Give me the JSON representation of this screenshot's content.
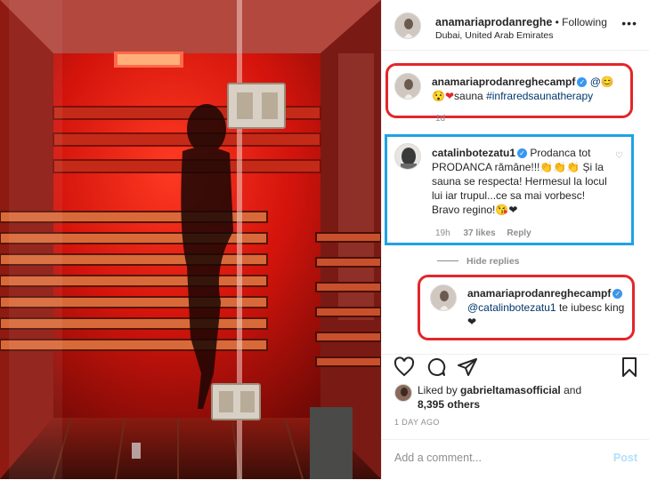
{
  "post": {
    "author": "anamariaprodanreghe",
    "follow_status": "• Following",
    "location": "Dubai, United Arab Emirates"
  },
  "caption": {
    "author": "anamariaprodanreghecampf",
    "mention": "@",
    "emoji_1": "😊",
    "emoji_2": "😯",
    "heart": "❤",
    "text": "sauna",
    "hashtag": "#infraredsaunatherapy",
    "time": "1d"
  },
  "comment": {
    "author": "catalinbotezatu1",
    "text": "Prodanca tot PRODANCA rămâne!!!👏👏👏 Și la sauna se respecta! Hermesul la locul lui iar trupul...ce sa mai vorbesc! Bravo regino!😘❤",
    "time": "19h",
    "likes": "37 likes",
    "reply_label": "Reply"
  },
  "hide_replies": "Hide replies",
  "reply": {
    "author": "anamariaprodanreghecampf",
    "mention": "@catalinbotezatu1",
    "text": "te iubesc king ❤"
  },
  "likes": {
    "prefix": "Liked by",
    "user": "gabrieltamasofficial",
    "and": "and",
    "others": "8,395 others"
  },
  "date": "1 DAY AGO",
  "add_comment": {
    "placeholder": "Add a comment...",
    "post_label": "Post"
  },
  "colors": {
    "highlight_red": "#e3262b",
    "highlight_blue": "#1fa2e6",
    "verified": "#3897f0",
    "heart": "#ed4956",
    "sauna_red": "#e01a12"
  },
  "icons": [
    "more-icon",
    "heart-icon",
    "comment-icon",
    "share-icon",
    "bookmark-icon",
    "verified-icon",
    "small-heart-icon"
  ]
}
